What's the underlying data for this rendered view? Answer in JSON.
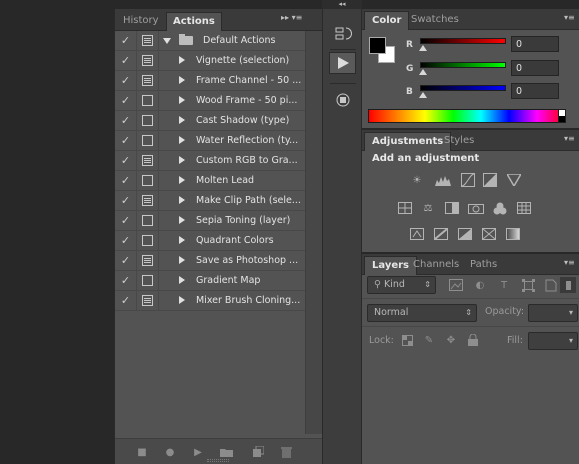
{
  "collapse_strip": {
    "icon": "double-chevron-left"
  },
  "actions_panel": {
    "tabs": [
      {
        "label": "History",
        "active": false
      },
      {
        "label": "Actions",
        "active": true
      }
    ],
    "menu_glyphs": "▸▸ ▾≡",
    "default_folder": "Default Actions",
    "actions": [
      {
        "label": "Vignette (selection)",
        "dialog": true
      },
      {
        "label": "Frame Channel - 50 ...",
        "dialog": true
      },
      {
        "label": "Wood Frame - 50 pi...",
        "dialog": false
      },
      {
        "label": "Cast Shadow (type)",
        "dialog": false
      },
      {
        "label": "Water Reflection (ty...",
        "dialog": false
      },
      {
        "label": "Custom RGB to Gra...",
        "dialog": true
      },
      {
        "label": "Molten Lead",
        "dialog": false
      },
      {
        "label": "Make Clip Path (sele...",
        "dialog": true
      },
      {
        "label": "Sepia Toning (layer)",
        "dialog": false
      },
      {
        "label": "Quadrant Colors",
        "dialog": false
      },
      {
        "label": "Save as Photoshop ...",
        "dialog": true
      },
      {
        "label": "Gradient Map",
        "dialog": false
      },
      {
        "label": "Mixer Brush Cloning...",
        "dialog": true
      }
    ],
    "check_glyph": "✓"
  },
  "color_panel": {
    "tabs": [
      {
        "label": "Color",
        "active": true
      },
      {
        "label": "Swatches",
        "active": false
      }
    ],
    "foreground": "#000000",
    "background": "#ffffff",
    "channels": [
      {
        "letter": "R",
        "value": "0",
        "gradient": "linear-gradient(to right,#000,#ff0000)"
      },
      {
        "letter": "G",
        "value": "0",
        "gradient": "linear-gradient(to right,#000,#00ff00)"
      },
      {
        "letter": "B",
        "value": "0",
        "gradient": "linear-gradient(to right,#000,#0000ff)"
      }
    ]
  },
  "adjustments_panel": {
    "tabs": [
      {
        "label": "Adjustments",
        "active": true
      },
      {
        "label": "Styles",
        "active": false
      }
    ],
    "title": "Add an adjustment"
  },
  "layers_panel": {
    "tabs": [
      {
        "label": "Layers",
        "active": true
      },
      {
        "label": "Channels",
        "active": false
      },
      {
        "label": "Paths",
        "active": false
      }
    ],
    "filter_kind": "Kind",
    "blend_mode": "Normal",
    "opacity_label": "Opacity:",
    "lock_label": "Lock:",
    "fill_label": "Fill:"
  }
}
